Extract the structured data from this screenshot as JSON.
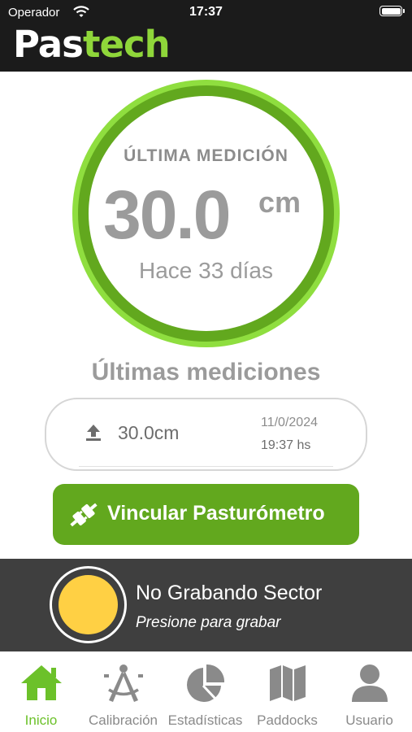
{
  "status_bar": {
    "carrier": "Operador",
    "time": "17:37"
  },
  "header": {
    "logo_part1": "Pas",
    "logo_part2": "tech"
  },
  "measurement": {
    "label": "ÚLTIMA MEDICIÓN",
    "value": "30.0",
    "unit": "cm",
    "ago": "Hace 33 días"
  },
  "history": {
    "title": "Últimas mediciones",
    "items": [
      {
        "value": "30.0cm",
        "date": "11/0/2024",
        "time": "19:37 hs",
        "icon": "upload-icon"
      }
    ]
  },
  "link_button": {
    "label": "Vincular Pasturómetro",
    "icon": "plug-icon"
  },
  "recording": {
    "status": "No Grabando Sector",
    "hint": "Presione para grabar",
    "indicator_color": "#ffd044"
  },
  "tabs": [
    {
      "label": "Inicio",
      "icon": "home-icon",
      "active": true
    },
    {
      "label": "Calibración",
      "icon": "compass-icon"
    },
    {
      "label": "Estadísticas",
      "icon": "pie-chart-icon"
    },
    {
      "label": "Paddocks",
      "icon": "map-icon"
    },
    {
      "label": "Usuario",
      "icon": "user-icon"
    }
  ],
  "colors": {
    "brand_green": "#62a81e",
    "ring_light_green": "#8fde3f",
    "active_tab": "#6cc12a",
    "header_bg": "#1b1b1b",
    "panel_bg": "#3f3f3f"
  }
}
